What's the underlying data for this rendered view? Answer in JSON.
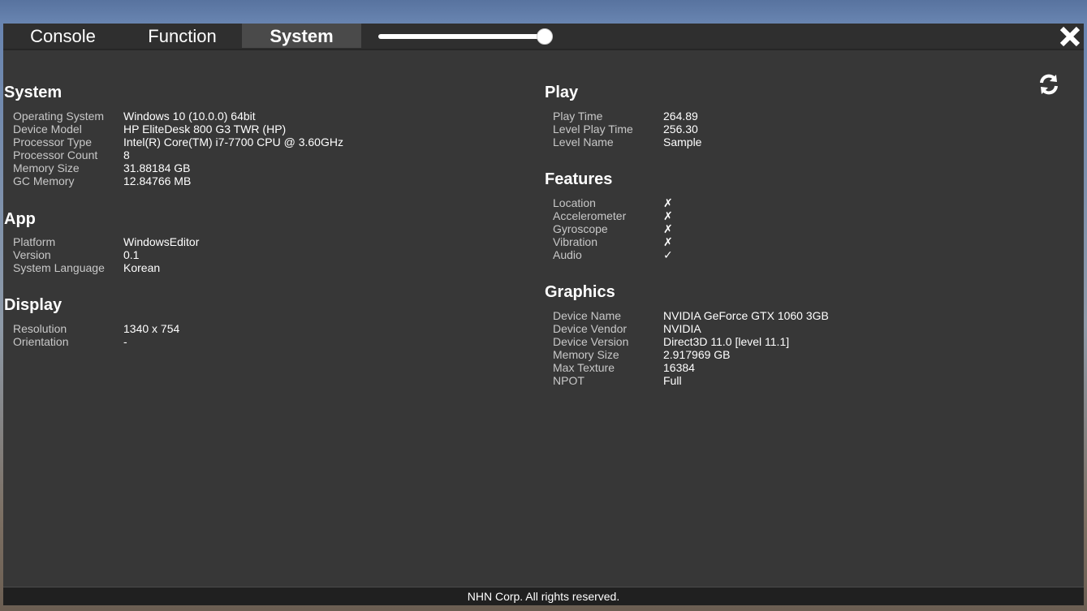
{
  "tabs": [
    {
      "label": "Console"
    },
    {
      "label": "Function"
    },
    {
      "label": "System"
    }
  ],
  "active_tab": "System",
  "slider_value": 1.0,
  "icons": {
    "close": "close-icon",
    "refresh": "refresh-icon"
  },
  "sections": {
    "system": {
      "title": "System",
      "rows": [
        {
          "key": "Operating System",
          "value": "Windows 10  (10.0.0) 64bit"
        },
        {
          "key": "Device Model",
          "value": "HP EliteDesk 800 G3 TWR (HP)"
        },
        {
          "key": "Processor Type",
          "value": "Intel(R) Core(TM) i7-7700 CPU @ 3.60GHz"
        },
        {
          "key": "Processor Count",
          "value": "8"
        },
        {
          "key": "Memory Size",
          "value": "31.88184 GB"
        },
        {
          "key": "GC Memory",
          "value": "12.84766 MB"
        }
      ]
    },
    "app": {
      "title": "App",
      "rows": [
        {
          "key": "Platform",
          "value": "WindowsEditor"
        },
        {
          "key": "Version",
          "value": "0.1"
        },
        {
          "key": "System Language",
          "value": "Korean"
        }
      ]
    },
    "display": {
      "title": "Display",
      "rows": [
        {
          "key": "Resolution",
          "value": "1340 x 754"
        },
        {
          "key": "Orientation",
          "value": "-"
        }
      ]
    },
    "play": {
      "title": "Play",
      "rows": [
        {
          "key": "Play Time",
          "value": "264.89"
        },
        {
          "key": "Level Play Time",
          "value": "256.30"
        },
        {
          "key": "Level Name",
          "value": "Sample"
        }
      ]
    },
    "features": {
      "title": "Features",
      "rows": [
        {
          "key": "Location",
          "value": "✗"
        },
        {
          "key": "Accelerometer",
          "value": "✗"
        },
        {
          "key": "Gyroscope",
          "value": "✗"
        },
        {
          "key": "Vibration",
          "value": "✗"
        },
        {
          "key": "Audio",
          "value": "✓"
        }
      ]
    },
    "graphics": {
      "title": "Graphics",
      "rows": [
        {
          "key": "Device Name",
          "value": "NVIDIA GeForce GTX 1060 3GB"
        },
        {
          "key": "Device Vendor",
          "value": "NVIDIA"
        },
        {
          "key": "Device Version",
          "value": "Direct3D 11.0 [level 11.1]"
        },
        {
          "key": "Memory Size",
          "value": "2.917969 GB"
        },
        {
          "key": "Max Texture",
          "value": "16384"
        },
        {
          "key": "NPOT",
          "value": "Full"
        }
      ]
    }
  },
  "footer": "NHN Corp. All rights reserved."
}
